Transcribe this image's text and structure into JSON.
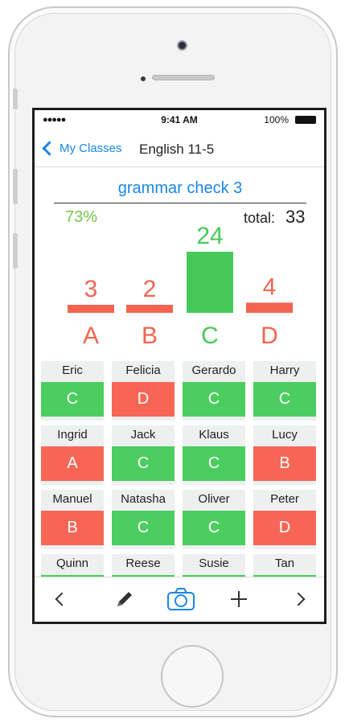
{
  "status": {
    "signal": "●●●●● ",
    "time": "9:41 AM",
    "battery": "100%"
  },
  "nav": {
    "back_label": "My Classes",
    "title": "English 11-5"
  },
  "assignment": {
    "title": "grammar check 3",
    "percent": "73%",
    "total_label": "total:",
    "total_value": "33"
  },
  "chart_data": {
    "type": "bar",
    "categories": [
      "A",
      "B",
      "C",
      "D"
    ],
    "values": [
      3,
      2,
      24,
      4
    ],
    "colors": [
      "#f26450",
      "#f26450",
      "#47c95a",
      "#f26450"
    ],
    "ylim": [
      0,
      24
    ]
  },
  "students": [
    {
      "name": "Eric",
      "grade": "C",
      "color": "#4ccd5f"
    },
    {
      "name": "Felicia",
      "grade": "D",
      "color": "#f76655"
    },
    {
      "name": "Gerardo",
      "grade": "C",
      "color": "#4ccd5f"
    },
    {
      "name": "Harry",
      "grade": "C",
      "color": "#4ccd5f"
    },
    {
      "name": "Ingrid",
      "grade": "A",
      "color": "#f76655"
    },
    {
      "name": "Jack",
      "grade": "C",
      "color": "#4ccd5f"
    },
    {
      "name": "Klaus",
      "grade": "C",
      "color": "#4ccd5f"
    },
    {
      "name": "Lucy",
      "grade": "B",
      "color": "#f76655"
    },
    {
      "name": "Manuel",
      "grade": "B",
      "color": "#f76655"
    },
    {
      "name": "Natasha",
      "grade": "C",
      "color": "#4ccd5f"
    },
    {
      "name": "Oliver",
      "grade": "C",
      "color": "#4ccd5f"
    },
    {
      "name": "Peter",
      "grade": "D",
      "color": "#f76655"
    },
    {
      "name": "Quinn",
      "grade": "",
      "color": "#4ccd5f"
    },
    {
      "name": "Reese",
      "grade": "",
      "color": "#4ccd5f"
    },
    {
      "name": "Susie",
      "grade": "",
      "color": "#4ccd5f"
    },
    {
      "name": "Tan",
      "grade": "",
      "color": "#4ccd5f"
    }
  ],
  "toolbar": {
    "back_icon": "chevron-left-icon",
    "edit_icon": "pencil-icon",
    "camera_icon": "camera-icon",
    "add_icon": "plus-icon",
    "forward_icon": "chevron-right-icon",
    "accent": "#1a86e8"
  }
}
